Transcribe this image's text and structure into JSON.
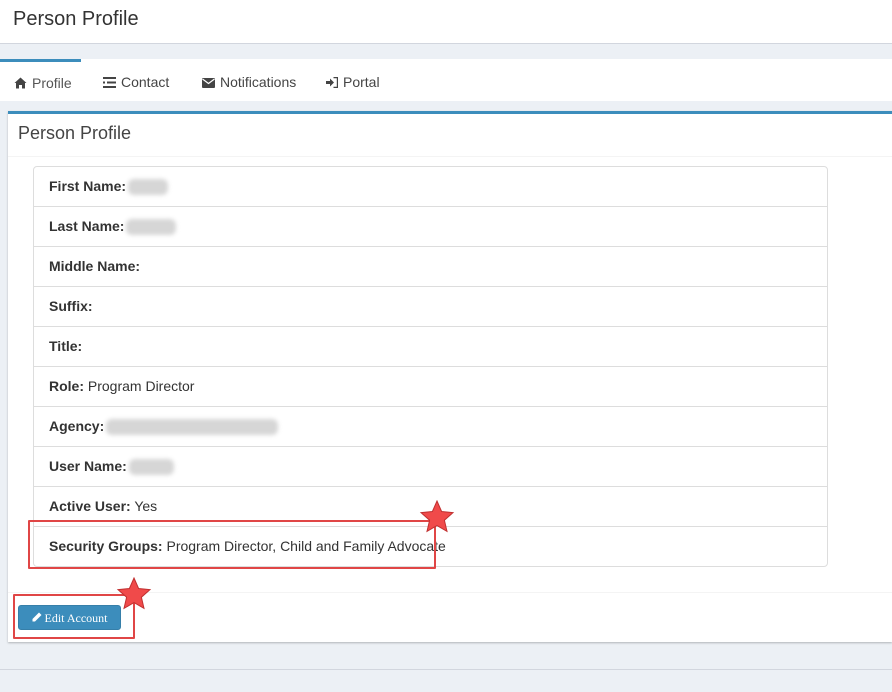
{
  "header": {
    "title": "Person Profile"
  },
  "tabs": [
    {
      "label": "Profile",
      "icon": "home-icon",
      "active": true
    },
    {
      "label": "Contact",
      "icon": "list-icon"
    },
    {
      "label": "Notifications",
      "icon": "envelope-icon"
    },
    {
      "label": "Portal",
      "icon": "sign-in-icon"
    }
  ],
  "panel": {
    "title": "Person Profile",
    "fields": [
      {
        "label": "First Name:",
        "value": ""
      },
      {
        "label": "Last Name:",
        "value": ""
      },
      {
        "label": "Middle Name:",
        "value": ""
      },
      {
        "label": "Suffix:",
        "value": ""
      },
      {
        "label": "Title:",
        "value": ""
      },
      {
        "label": "Role:",
        "value": "Program Director"
      },
      {
        "label": "Agency:",
        "value": ""
      },
      {
        "label": "User Name:",
        "value": ""
      },
      {
        "label": "Active User:",
        "value": "Yes"
      },
      {
        "label": "Security Groups:",
        "value": "Program Director, Child and Family Advocate"
      }
    ],
    "edit_button": "Edit Account"
  },
  "colors": {
    "accent": "#3c8dbc",
    "highlight": "#e04646",
    "star": "#f04a4a"
  }
}
